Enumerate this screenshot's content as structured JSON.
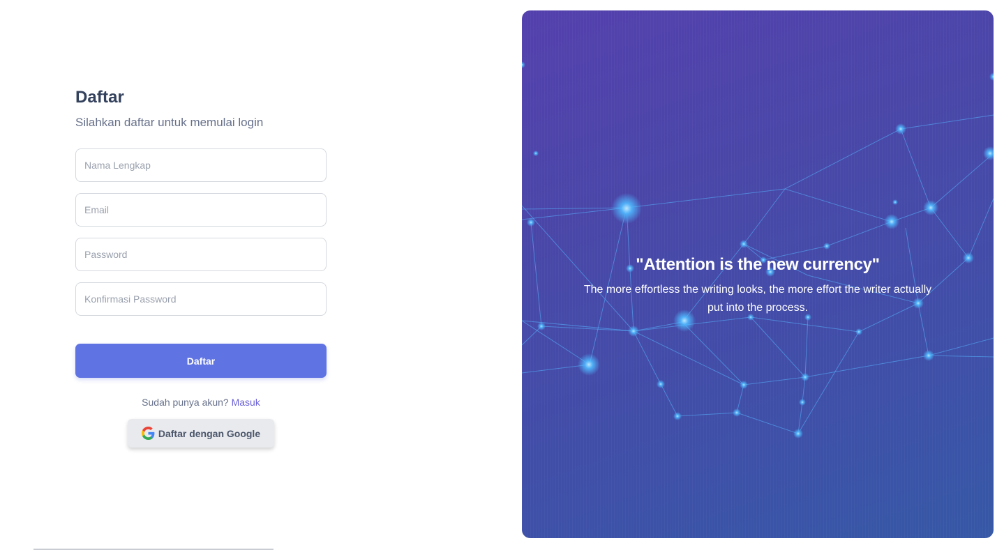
{
  "form": {
    "title": "Daftar",
    "subtitle": "Silahkan daftar untuk memulai login",
    "fields": {
      "full_name": {
        "placeholder": "Nama Lengkap",
        "value": ""
      },
      "email": {
        "placeholder": "Email",
        "value": ""
      },
      "password": {
        "placeholder": "Password",
        "value": ""
      },
      "confirm_password": {
        "placeholder": "Konfirmasi Password",
        "value": ""
      }
    },
    "submit_label": "Daftar",
    "signin_prompt": "Sudah punya akun?",
    "signin_link": "Masuk",
    "google_label": "Daftar dengan Google",
    "google_icon": "google-g-logo"
  },
  "panel": {
    "quote_title": "\"Attention is the new currency\"",
    "quote_body": "The more effortless the writing looks, the more effort the writer actually put into the process."
  },
  "colors": {
    "primary": "#6073e3",
    "link": "#6b62d6",
    "title": "#33415c",
    "panel_start": "#5440ad",
    "panel_end": "#3658a6",
    "network_node": "#4fb8ff"
  }
}
